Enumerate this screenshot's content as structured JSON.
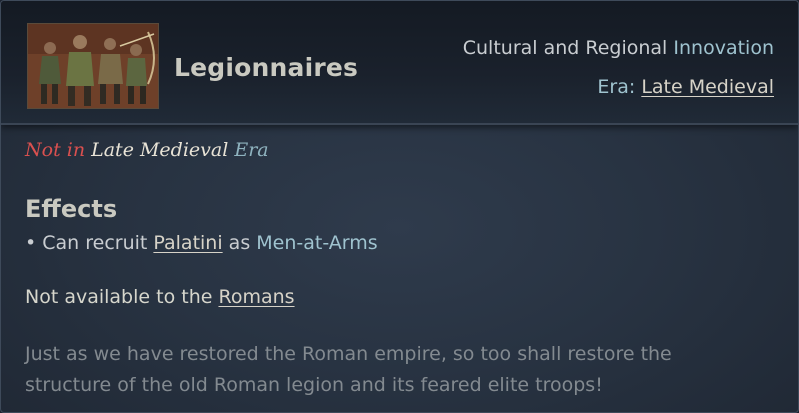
{
  "header": {
    "title": "Legionnaires",
    "category_prefix": "Cultural and Regional",
    "category_highlight": "Innovation",
    "era_label": "Era:",
    "era_value": "Late Medieval"
  },
  "status": {
    "negation": "Not in",
    "era_name": "Late Medieval",
    "era_word": "Era"
  },
  "effects": {
    "heading": "Effects",
    "item_prefix": "• Can recruit",
    "item_link": "Palatini",
    "item_middle": "as",
    "item_highlight": "Men-at-Arms"
  },
  "availability": {
    "prefix": "Not available to the",
    "link": "Romans"
  },
  "flavor": {
    "line1": "Just as we have restored the Roman empire, so too shall restore the",
    "line2": "structure of the old Roman legion and its feared elite troops!"
  },
  "colors": {
    "negative": "#d9504f",
    "highlight": "#9fc3cf",
    "flavor": "#838a90"
  }
}
